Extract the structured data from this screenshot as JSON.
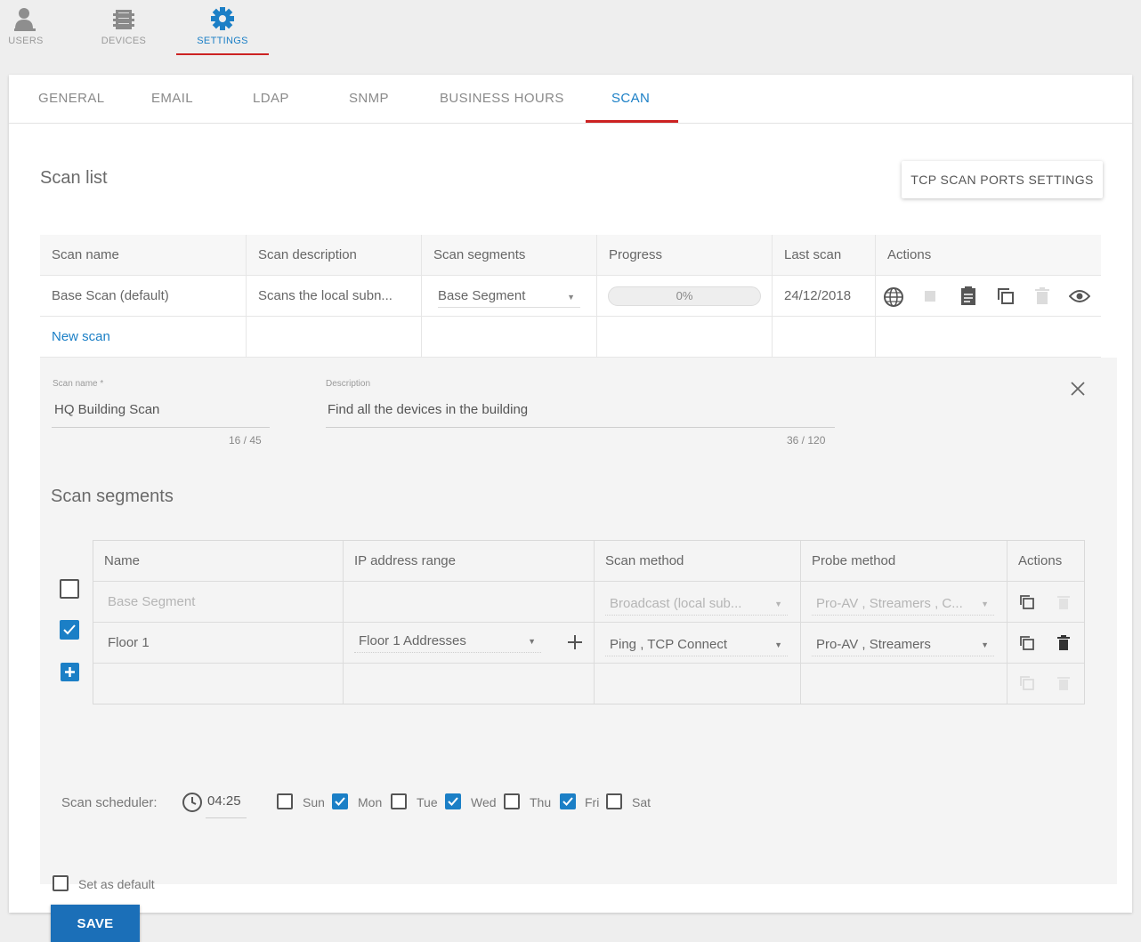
{
  "topnav": {
    "items": [
      {
        "label": "USERS",
        "icon": "users-icon"
      },
      {
        "label": "DEVICES",
        "icon": "devices-icon"
      },
      {
        "label": "SETTINGS",
        "icon": "gear-icon",
        "active": true
      }
    ]
  },
  "tabs": [
    {
      "label": "GENERAL"
    },
    {
      "label": "EMAIL"
    },
    {
      "label": "LDAP"
    },
    {
      "label": "SNMP"
    },
    {
      "label": "BUSINESS HOURS"
    },
    {
      "label": "SCAN",
      "active": true
    }
  ],
  "scan_list": {
    "title": "Scan list",
    "tcp_button": "TCP SCAN PORTS SETTINGS",
    "columns": [
      "Scan name",
      "Scan description",
      "Scan segments",
      "Progress",
      "Last scan",
      "Actions"
    ],
    "rows": [
      {
        "name": "Base Scan (default)",
        "description": "Scans the local subn...",
        "segment": "Base Segment",
        "progress_text": "0%",
        "progress": 0,
        "last_scan": "24/12/2018",
        "actions": [
          "globe-scan-icon",
          "stop-icon",
          "report-icon",
          "copy-icon",
          "delete-icon",
          "view-icon"
        ]
      }
    ],
    "new_scan_label": "New scan"
  },
  "form": {
    "scan_name_label": "Scan name *",
    "scan_name_value": "HQ Building Scan",
    "scan_name_counter": "16 / 45",
    "description_label": "Description",
    "description_value": "Find all the devices in the building",
    "description_counter": "36 / 120",
    "segments_title": "Scan segments",
    "segments_columns": [
      "Name",
      "IP address range",
      "Scan method",
      "Probe method",
      "Actions"
    ],
    "segments": [
      {
        "name": "Base Segment",
        "ip_range": "",
        "scan_method": "Broadcast (local sub...",
        "probe_method": "Pro-AV , Streamers , C...",
        "checked": false,
        "disabled": true
      },
      {
        "name": "Floor 1",
        "ip_range": "Floor 1 Addresses",
        "scan_method": "Ping , TCP Connect",
        "probe_method": "Pro-AV , Streamers",
        "checked": true,
        "disabled": false
      }
    ],
    "scheduler_label": "Scan scheduler:",
    "scheduler_time": "04:25",
    "days": [
      {
        "label": "Sun",
        "checked": false
      },
      {
        "label": "Mon",
        "checked": true
      },
      {
        "label": "Tue",
        "checked": false
      },
      {
        "label": "Wed",
        "checked": true
      },
      {
        "label": "Thu",
        "checked": false
      },
      {
        "label": "Fri",
        "checked": true
      },
      {
        "label": "Sat",
        "checked": false
      }
    ],
    "set_default_label": "Set as default",
    "save_label": "SAVE"
  },
  "colors": {
    "accent": "#1b7fc6",
    "tab_underline": "#cc2222",
    "save_button": "#1b6fb8"
  }
}
